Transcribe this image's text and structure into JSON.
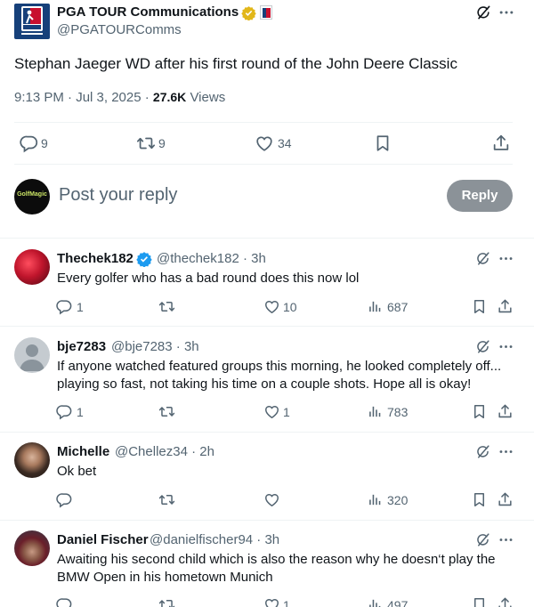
{
  "main_tweet": {
    "author_name": "PGA TOUR Communications",
    "author_handle": "@PGATOURComms",
    "text": "Stephan Jaeger  WD after his first round of the John Deere Classic",
    "time": "9:13 PM · Jul 3, 2025 · ",
    "views_count": "27.6K",
    "views_label": " Views",
    "replies": "9",
    "retweets": "9",
    "likes": "34"
  },
  "reply_box": {
    "avatar_text": "GolfMagic",
    "placeholder": "Post your reply",
    "button_label": "Reply"
  },
  "replies": [
    {
      "name": "Thechek182",
      "handle": "@thechek182 · 3h",
      "verified": true,
      "text": "Every golfer who has a bad round does this now lol",
      "replies": "1",
      "retweets": "",
      "likes": "10",
      "views": "687"
    },
    {
      "name": "bje7283",
      "handle": "@bje7283 · 3h",
      "verified": false,
      "text_line1": "If anyone watched featured groups this morning, he looked completely off...",
      "text_line2": "playing so fast, not taking his time on a couple shots. Hope all is okay!",
      "replies": "1",
      "retweets": "",
      "likes": "1",
      "views": "783"
    },
    {
      "name": "Michelle",
      "handle": "@Chellez34 · 2h",
      "verified": false,
      "text": "Ok bet",
      "replies": "",
      "retweets": "",
      "likes": "",
      "views": "320"
    },
    {
      "name": "Daniel Fischer",
      "handle": "@danielfischer94 · 3h",
      "verified": false,
      "text_line1": "Awaiting his second child which is also the reason why he doesn‘t play the",
      "text_line2": "BMW Open in his hometown Munich",
      "replies": "",
      "retweets": "",
      "likes": "1",
      "views": "497"
    }
  ],
  "colors": {
    "accent_blue": "#1d9bf0",
    "muted_text": "#536471",
    "verified_gold": "#e2b719",
    "reply_button_disabled": "#8b9298",
    "pga_navy": "#16407a"
  },
  "icons": [
    "grok-icon",
    "more-icon",
    "reply-icon",
    "retweet-icon",
    "like-icon",
    "bookmark-icon",
    "share-icon",
    "views-icon",
    "verified-icon"
  ]
}
